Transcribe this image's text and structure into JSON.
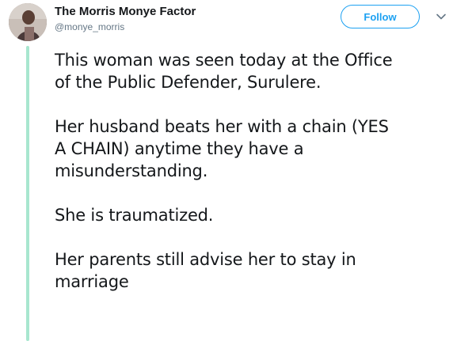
{
  "tweet": {
    "author": {
      "name": "The Morris Monye Factor",
      "handle": "@monye_morris"
    },
    "follow_label": "Follow",
    "paragraphs": [
      [
        "This woman was seen today at the Office",
        "of the Public Defender, Surulere."
      ],
      [
        "Her husband beats her with a chain (YES",
        "A CHAIN) anytime they have a",
        "misunderstanding."
      ],
      [
        "She is traumatized."
      ],
      [
        "Her parents still advise her to stay in",
        "marriage"
      ]
    ]
  },
  "colors": {
    "accent": "#1da1f2",
    "thread_line": "#a8e6cf",
    "text": "#14171a",
    "secondary_text": "#657786"
  },
  "icons": {
    "more": "chevron-down-icon",
    "avatar": "profile-photo"
  }
}
